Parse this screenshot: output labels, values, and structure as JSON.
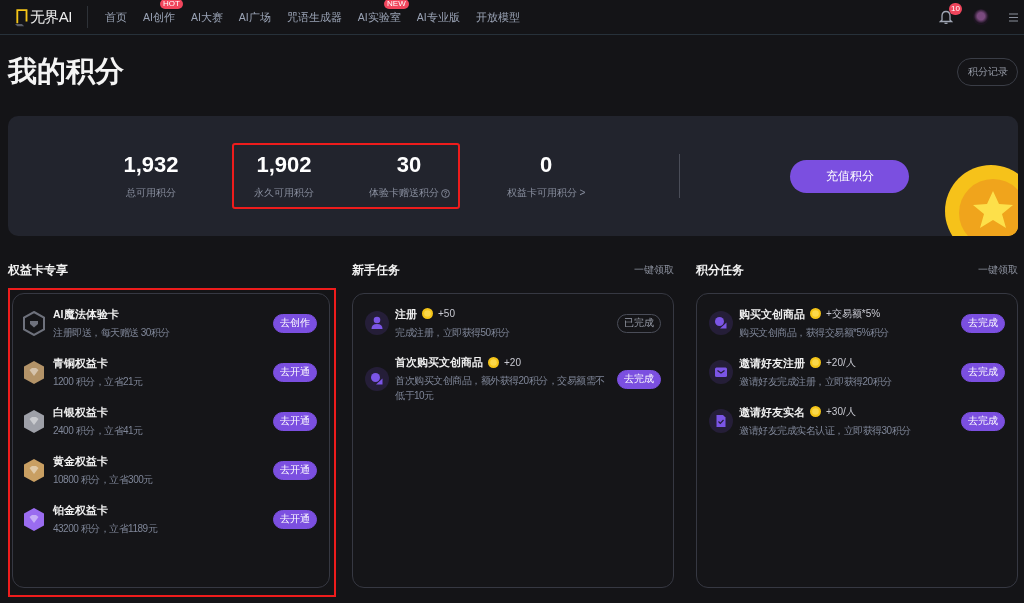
{
  "nav": {
    "logo": "无界AI",
    "items": [
      {
        "label": "首页"
      },
      {
        "label": "AI创作",
        "badge": "HOT"
      },
      {
        "label": "AI大赛"
      },
      {
        "label": "AI广场"
      },
      {
        "label": "咒语生成器"
      },
      {
        "label": "AI实验室",
        "badge": "NEW"
      },
      {
        "label": "AI专业版"
      },
      {
        "label": "开放模型"
      }
    ],
    "notification_count": "10"
  },
  "header": {
    "title": "我的积分",
    "records_button": "积分记录"
  },
  "summary": {
    "groups": [
      {
        "highlighted": false,
        "stats": [
          {
            "value": "1,932",
            "label": "总可用积分",
            "help": false
          }
        ]
      },
      {
        "highlighted": true,
        "stats": [
          {
            "value": "1,902",
            "label": "永久可用积分",
            "help": false
          },
          {
            "value": "30",
            "label": "体验卡赠送积分",
            "help": true
          }
        ]
      },
      {
        "highlighted": false,
        "stats": [
          {
            "value": "0",
            "label": "权益卡可用积分 >",
            "help": false
          }
        ]
      }
    ],
    "recharge_button": "充值积分"
  },
  "sections": [
    {
      "kind": "benefits",
      "title": "权益卡专享",
      "highlighted": true,
      "items": [
        {
          "kind": "trial",
          "name": "AI魔法体验卡",
          "description": "注册即送，每天赠送 30积分",
          "color": "#6e717c",
          "button": "去创作"
        },
        {
          "kind": "tier",
          "name": "青铜权益卡",
          "description": "1200 积分，立省21元",
          "color": "#b39368",
          "button": "去开通"
        },
        {
          "kind": "tier",
          "name": "白银权益卡",
          "description": "2400 积分，立省41元",
          "color": "#9ea0a8",
          "button": "去开通"
        },
        {
          "kind": "tier",
          "name": "黄金权益卡",
          "description": "10800 积分，立省300元",
          "color": "#c99f62",
          "button": "去开通"
        },
        {
          "kind": "tier",
          "name": "铂金权益卡",
          "description": "43200 积分，立省1189元",
          "color": "#9a6cf0",
          "button": "去开通"
        }
      ]
    },
    {
      "kind": "tasks",
      "title": "新手任务",
      "action": "一键领取",
      "highlighted": false,
      "items": [
        {
          "kind": "user",
          "title": "注册",
          "reward": "+50",
          "description": "完成注册，立即获得50积分",
          "completed": true,
          "button": "已完成"
        },
        {
          "kind": "shop",
          "title": "首次购买文创商品",
          "reward": "+20",
          "description": "首次购买文创商品，额外获得20积分，交易额需不低于10元",
          "completed": false,
          "button": "去完成"
        }
      ]
    },
    {
      "kind": "tasks",
      "title": "积分任务",
      "action": "一键领取",
      "highlighted": false,
      "items": [
        {
          "kind": "shop",
          "title": "购买文创商品",
          "reward": "+交易额*5%",
          "description": "购买文创商品，获得交易额*5%积分",
          "completed": false,
          "button": "去完成"
        },
        {
          "kind": "mail",
          "title": "邀请好友注册",
          "reward": "+20/人",
          "description": "邀请好友完成注册，立即获得20积分",
          "completed": false,
          "button": "去完成"
        },
        {
          "kind": "doc",
          "title": "邀请好友实名",
          "reward": "+30/人",
          "description": "邀请好友完成实名认证，立即获得30积分",
          "completed": false,
          "button": "去完成"
        }
      ]
    }
  ]
}
